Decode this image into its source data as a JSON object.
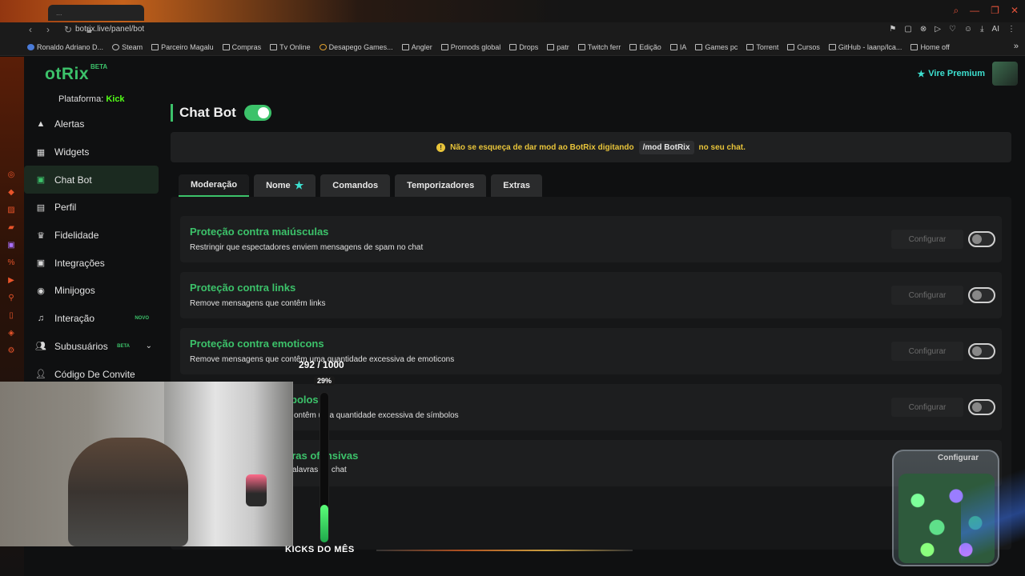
{
  "browser": {
    "tab_title": "...",
    "url": "botrix.live/panel/bot",
    "bookmarks": [
      "Ronaldo Adriano D...",
      "Steam",
      "Parceiro Magalu",
      "Compras",
      "Tv Online",
      "Desapego Games...",
      "Angler",
      "Promods global",
      "Drops",
      "patr",
      "Twitch ferr",
      "Edição",
      "IA",
      "Games pc",
      "Torrent",
      "Cursos",
      "GitHub - laanp/lca...",
      "Home off"
    ],
    "ai_label": "AI"
  },
  "app": {
    "logo": "otRix",
    "logo_badge": "BETA",
    "premium": "Vire Premium",
    "platform_label": "Plataforma:",
    "platform_value": "Kick"
  },
  "sidebar": {
    "items": [
      {
        "label": "Alertas",
        "icon": "warning-icon"
      },
      {
        "label": "Widgets",
        "icon": "grid-icon"
      },
      {
        "label": "Chat Bot",
        "icon": "robot-icon",
        "active": true
      },
      {
        "label": "Perfil",
        "icon": "id-card-icon"
      },
      {
        "label": "Fidelidade",
        "icon": "trophy-icon"
      },
      {
        "label": "Integrações",
        "icon": "plug-icon"
      },
      {
        "label": "Minijogos",
        "icon": "gamepad-icon"
      },
      {
        "label": "Interação",
        "icon": "music-icon",
        "badge": "NOVO"
      },
      {
        "label": "Subusuários",
        "icon": "users-icon",
        "badge": "BETA"
      },
      {
        "label": "Código De Convite",
        "icon": "user-plus-icon"
      }
    ]
  },
  "main": {
    "title": "Chat Bot",
    "notice_before": "Não se esqueça de dar mod ao BotRix digitando",
    "notice_code": "/mod BotRix",
    "notice_after": "no seu chat.",
    "tabs": [
      {
        "label": "Moderação",
        "active": true
      },
      {
        "label": "Nome",
        "star": true
      },
      {
        "label": "Comandos"
      },
      {
        "label": "Temporizadores"
      },
      {
        "label": "Extras"
      }
    ],
    "configure_label": "Configurar",
    "cards": [
      {
        "title": "Proteção contra maiúsculas",
        "desc": "Restringir que espectadores enviem mensagens de spam no chat"
      },
      {
        "title": "Proteção contra links",
        "desc": "Remove mensagens que contêm links"
      },
      {
        "title": "Proteção contra emoticons",
        "desc": "Remove mensagens que contêm uma quantidade excessiva de emoticons"
      },
      {
        "title": "bolos",
        "desc": "ontêm uma quantidade excessiva de símbolos"
      },
      {
        "title": "vras ofensivas",
        "desc": "alavras no chat"
      }
    ]
  },
  "overlay": {
    "goal_count": "292 / 1000",
    "goal_pct": "29%",
    "goal_fraction": 0.29,
    "goal_label": "KICKS DO MÊS",
    "jar_label": "Configurar"
  },
  "colors": {
    "accent": "#3cc26a",
    "kick_green": "#53fc18",
    "notice": "#e8c43a"
  }
}
